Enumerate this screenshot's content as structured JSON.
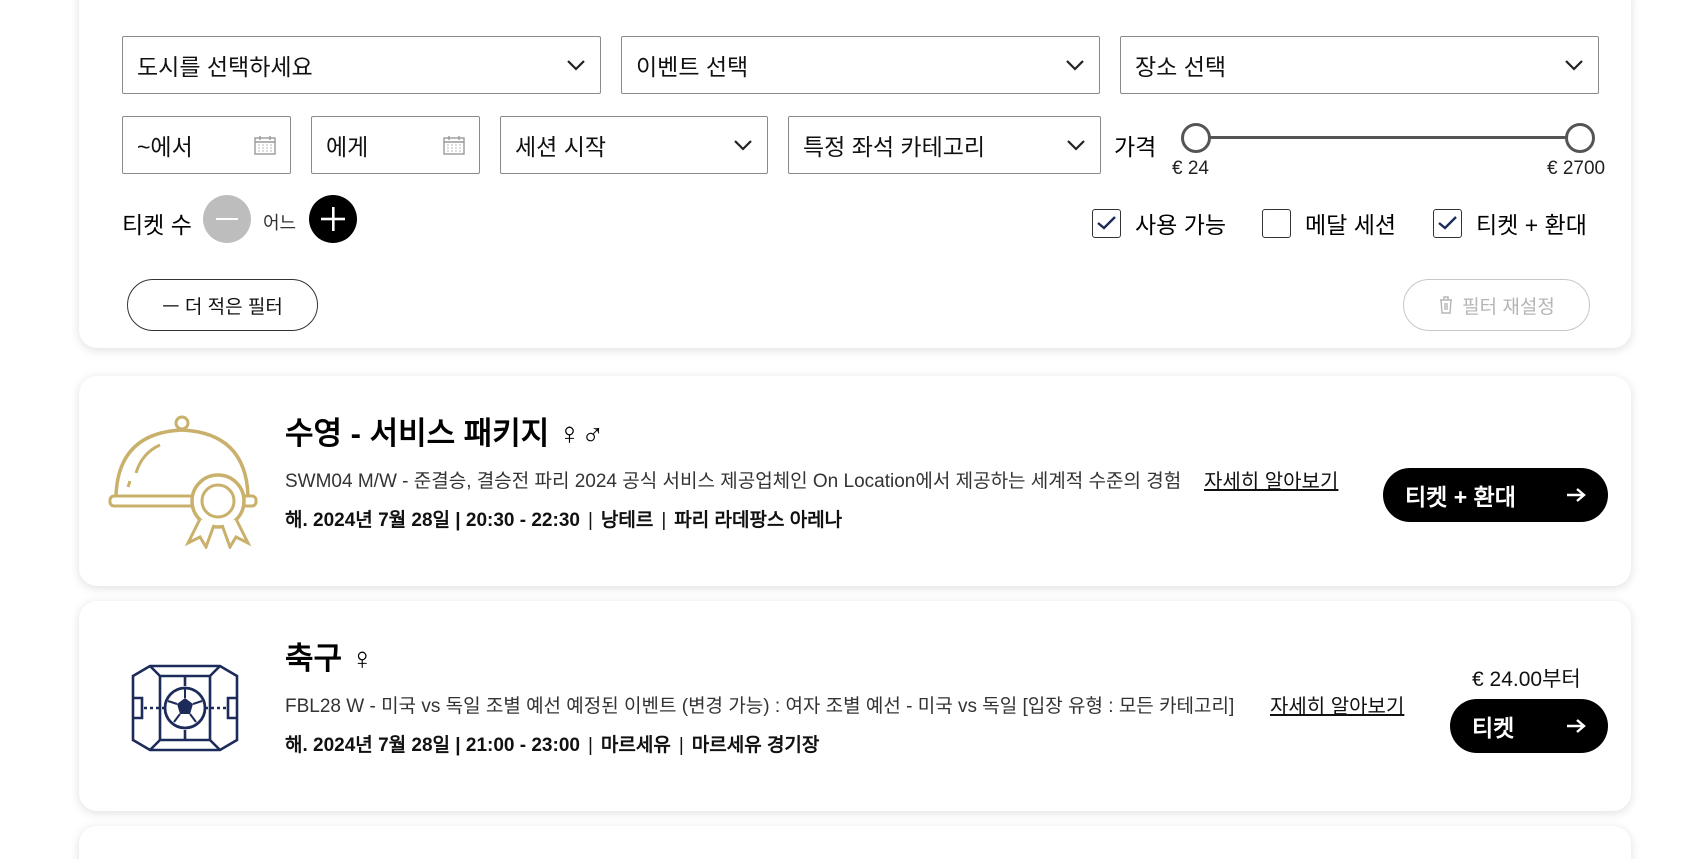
{
  "filters": {
    "city": {
      "label": "도시를 선택하세요"
    },
    "event": {
      "label": "이벤트 선택"
    },
    "venue": {
      "label": "장소 선택"
    },
    "date_from": {
      "label": "~에서"
    },
    "date_to": {
      "label": "에게"
    },
    "session_start": {
      "label": "세션 시작"
    },
    "seat_category": {
      "label": "특정 좌석 카테고리"
    },
    "price": {
      "label": "가격",
      "min_label": "€ 24",
      "max_label": "€ 2700",
      "min_value": 24,
      "max_value": 2700
    },
    "tickets": {
      "label": "티켓 수",
      "value_label": "어느"
    },
    "checkboxes": [
      {
        "label": "사용 가능",
        "checked": true
      },
      {
        "label": "메달 세션",
        "checked": false
      },
      {
        "label": "티켓 + 환대",
        "checked": true
      }
    ],
    "less_filters_label": "ㅡ 더 적은 필터",
    "reset_label": "필터 재설정"
  },
  "events": [
    {
      "icon": "cloche-award-icon",
      "title": "수영 - 서비스 패키지 ♀♂",
      "description": "SWM04 M/W - 준결승, 결승전 파리 2024 공식 서비스 제공업체인 On Location에서 제공하는 세계적 수준의 경험",
      "more_label": "자세히 알아보기",
      "date": "해. 2024년 7월 28일 | 20:30 - 22:30",
      "city": "낭테르",
      "venue": "파리 라데팡스 아레나",
      "price": "",
      "button_label": "티켓 + 환대"
    },
    {
      "icon": "football-pitch-icon",
      "title": "축구 ♀",
      "description": "FBL28 W - 미국 vs 독일 조별 예선 예정된 이벤트 (변경 가능) : 여자 조별 예선 - 미국 vs 독일 [입장 유형 : 모든 카테고리]",
      "more_label": "자세히 알아보기",
      "date": "해. 2024년 7월 28일 | 21:00 - 23:00",
      "city": "마르세유",
      "venue": "마르세유 경기장",
      "price": "€ 24.00부터",
      "button_label": "티켓"
    }
  ],
  "colors": {
    "gold": "#c9b06b",
    "navy": "#1c2b5a",
    "black": "#000000"
  }
}
